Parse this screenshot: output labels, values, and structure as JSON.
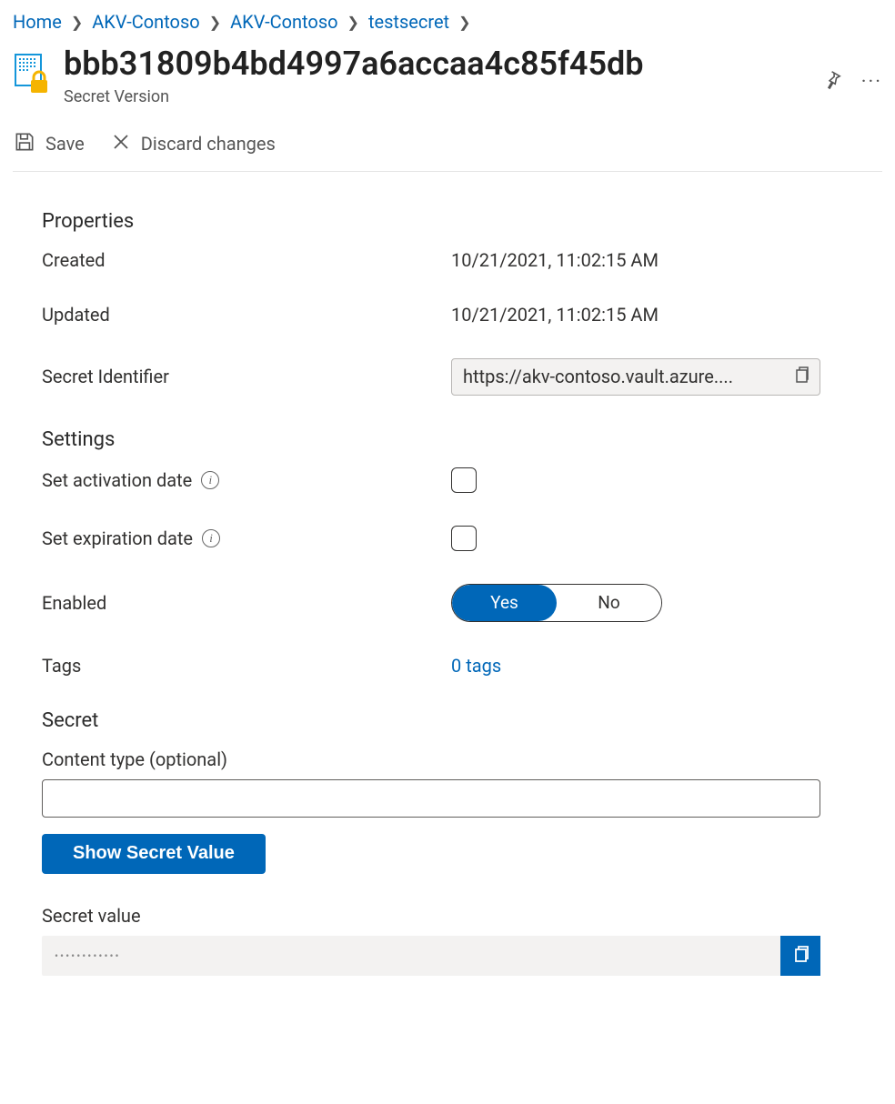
{
  "breadcrumb": {
    "items": [
      "Home",
      "AKV-Contoso",
      "AKV-Contoso",
      "testsecret"
    ]
  },
  "header": {
    "title": "bbb31809b4bd4997a6accaa4c85f45db",
    "subtitle": "Secret Version"
  },
  "toolbar": {
    "save_label": "Save",
    "discard_label": "Discard changes"
  },
  "properties": {
    "heading": "Properties",
    "created_label": "Created",
    "created_value": "10/21/2021, 11:02:15 AM",
    "updated_label": "Updated",
    "updated_value": "10/21/2021, 11:02:15 AM",
    "identifier_label": "Secret Identifier",
    "identifier_value": "https://akv-contoso.vault.azure...."
  },
  "settings": {
    "heading": "Settings",
    "activation_label": "Set activation date",
    "expiration_label": "Set expiration date",
    "enabled_label": "Enabled",
    "enabled_yes": "Yes",
    "enabled_no": "No",
    "tags_label": "Tags",
    "tags_value": "0 tags"
  },
  "secret": {
    "heading": "Secret",
    "content_type_label": "Content type (optional)",
    "content_type_value": "",
    "show_value_btn": "Show Secret Value",
    "secret_value_label": "Secret value",
    "secret_value_masked": "••••••••••••"
  }
}
